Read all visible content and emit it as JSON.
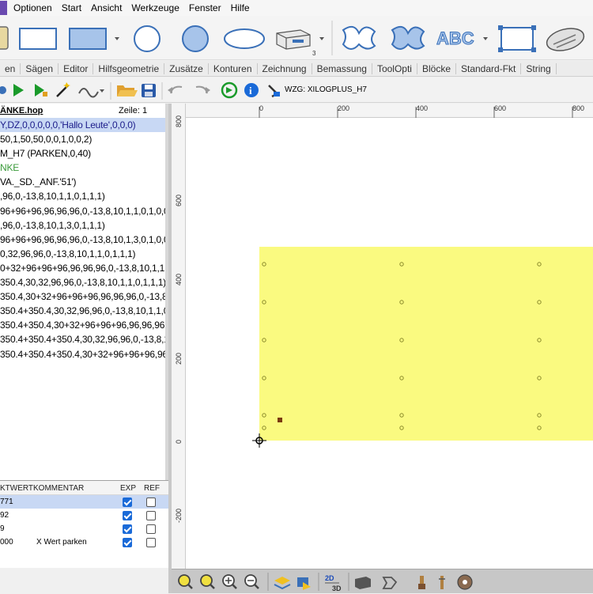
{
  "menu": {
    "items": [
      "Optionen",
      "Start",
      "Ansicht",
      "Werkzeuge",
      "Fenster",
      "Hilfe"
    ]
  },
  "shape_toolbar": {
    "text_tool_label": "ABC",
    "box_tool_badge": "3",
    "icons": [
      "rectangle-rounded-icon",
      "rectangle-icon",
      "filled-rectangle-icon",
      "circle-icon",
      "filled-circle-icon",
      "ellipse-icon",
      "box-3d-icon",
      "curve-icon",
      "filled-curve-icon",
      "text-icon",
      "select-frame-icon",
      "disc-icon"
    ]
  },
  "tabs": [
    "en",
    "Sägen",
    "Editor",
    "Hilfsgeometrie",
    "Zusätze",
    "Konturen",
    "Zeichnung",
    "Bemassung",
    "ToolOpti",
    "Blöcke",
    "Standard-Fkt",
    "String"
  ],
  "action_toolbar": {
    "wzg_label": "WZG: XILOGPLUS_H7",
    "icons": [
      "gear-icon",
      "play-icon",
      "play-step-icon",
      "magic-wand-icon",
      "route-icon",
      "folder-open-icon",
      "save-icon",
      "undo-icon",
      "redo-icon",
      "refresh-icon",
      "info-icon",
      "tool-icon"
    ]
  },
  "editor": {
    "file_name": "ÄNKE.hop",
    "line_label": "Zeile: 1",
    "lines": [
      {
        "text": "Y,DZ,0,0,0,0,0,'Hallo Leute',0,0,0)",
        "color": "#1b1b8a",
        "selected": true
      },
      {
        "text": "50,1,50,50,0,0,1,0,0,2)",
        "color": "#000000"
      },
      {
        "text": "M_H7  (PARKEN,0,40)",
        "color": "#000000",
        "prefix_color": "#1e3fbf"
      },
      {
        "text": "NKE",
        "color": "#3a9a3a"
      },
      {
        "text": "VA._SD._ANF.'51')",
        "color": "#000000"
      },
      {
        "text": ",96,0,-13,8,10,1,1,0,1,1,1)",
        "color": "#000000"
      },
      {
        "text": "96+96+96,96,96,96,0,-13,8,10,1,1,0,1,0,0",
        "color": "#000000"
      },
      {
        "text": ",96,0,-13,8,10,1,3,0,1,1,1)",
        "color": "#000000"
      },
      {
        "text": "96+96+96,96,96,96,0,-13,8,10,1,3,0,1,0,0",
        "color": "#000000"
      },
      {
        "text": "0,32,96,96,0,-13,8,10,1,1,0,1,1,1)",
        "color": "#000000"
      },
      {
        "text": "0+32+96+96+96,96,96,96,0,-13,8,10,1,1.",
        "color": "#000000"
      },
      {
        "text": "350.4,30,32,96,96,0,-13,8,10,1,1,0,1,1,1)",
        "color": "#000000"
      },
      {
        "text": "350.4,30+32+96+96+96,96,96,96,0,-13,8,",
        "color": "#000000"
      },
      {
        "text": "350.4+350.4,30,32,96,96,0,-13,8,10,1,1,0",
        "color": "#000000"
      },
      {
        "text": "350.4+350.4,30+32+96+96+96,96,96,96,0",
        "color": "#000000"
      },
      {
        "text": "350.4+350.4+350.4,30,32,96,96,0,-13,8,1",
        "color": "#000000"
      },
      {
        "text": "350.4+350.4+350.4,30+32+96+96+96,96,96",
        "color": "#000000"
      }
    ]
  },
  "variables": {
    "headers": {
      "wert": "KTWERT",
      "kommentar": "KOMMENTAR",
      "exp": "EXP",
      "ref": "REF"
    },
    "rows": [
      {
        "wert": "771",
        "kommentar": "",
        "exp": true,
        "ref": false,
        "selected": true
      },
      {
        "wert": "92",
        "kommentar": "",
        "exp": true,
        "ref": false
      },
      {
        "wert": "9",
        "kommentar": "",
        "exp": true,
        "ref": false
      },
      {
        "wert": "000",
        "kommentar": "X Wert parken",
        "exp": true,
        "ref": false
      }
    ]
  },
  "rulers": {
    "horizontal": [
      "0",
      "200",
      "400",
      "600",
      "800"
    ],
    "vertical": [
      "800",
      "600",
      "400",
      "200",
      "0",
      "-200"
    ]
  },
  "canvas": {
    "panel_color": "#fafa80",
    "drill_marker_color": "#8a8a2a",
    "part_marker_color": "#7a3a10"
  },
  "bottom_toolbar": {
    "view_2d3d": "2D",
    "view_3d": "3D",
    "icons": [
      "zoom-window-icon",
      "zoom-fit-icon",
      "zoom-in-icon",
      "zoom-out-icon",
      "layers-icon",
      "shapes-icon",
      "view-2d3d-icon",
      "solid-box-icon",
      "contour-icon",
      "tool-holder-icon",
      "drill-bit-icon",
      "saw-blade-icon"
    ]
  }
}
